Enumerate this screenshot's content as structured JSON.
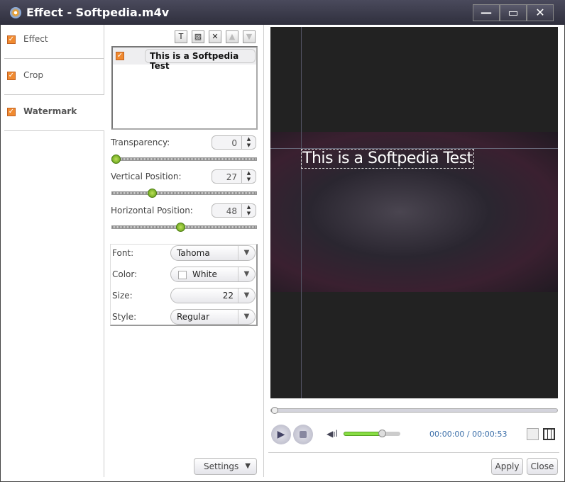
{
  "window": {
    "title": "Effect - Softpedia.m4v",
    "minimize": "—",
    "maximize": "▭",
    "close": "✕"
  },
  "sidebar": {
    "items": [
      {
        "label": "Effect",
        "checked": true
      },
      {
        "label": "Crop",
        "checked": true
      },
      {
        "label": "Watermark",
        "checked": true,
        "selected": true
      }
    ]
  },
  "toolbar": {
    "add_text": "T",
    "add_image": "▨",
    "delete": "✕",
    "up": "▲",
    "down": "▼"
  },
  "watermarks": [
    {
      "label": "This is a Softpedia Test",
      "checked": true
    }
  ],
  "transparency": {
    "label": "Transparency:",
    "value": "0",
    "percent": 0
  },
  "vertical": {
    "label": "Vertical Position:",
    "value": "27",
    "percent": 27
  },
  "horizontal": {
    "label": "Horizontal Position:",
    "value": "48",
    "percent": 48
  },
  "font": {
    "label": "Font:",
    "value": "Tahoma"
  },
  "color": {
    "label": "Color:",
    "value": "White",
    "swatch": "#ffffff"
  },
  "size": {
    "label": "Size:",
    "value": "22"
  },
  "style": {
    "label": "Style:",
    "value": "Regular"
  },
  "settings_label": "Settings",
  "preview": {
    "watermark_text": "This is a Softpedia Test"
  },
  "player": {
    "time": "00:00:00 / 00:00:53",
    "volume_percent": 68,
    "progress_percent": 0
  },
  "footer": {
    "apply": "Apply",
    "close": "Close"
  }
}
